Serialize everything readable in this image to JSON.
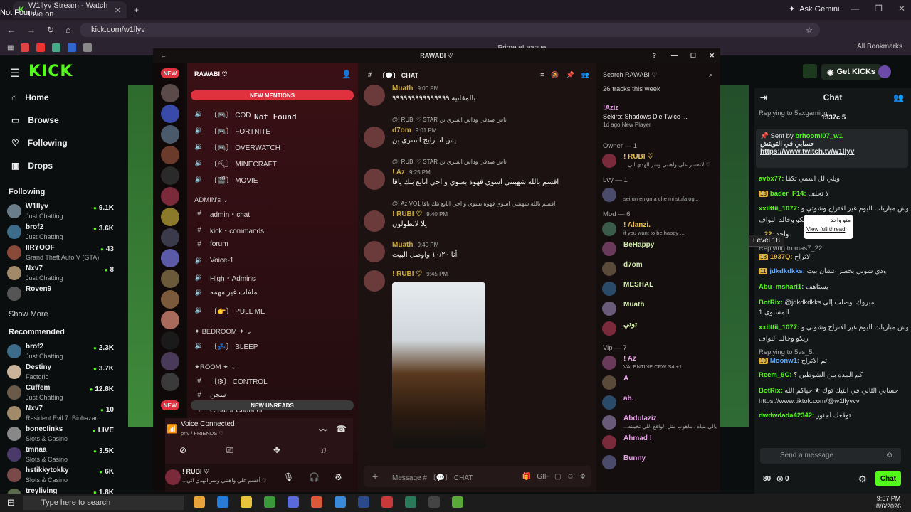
{
  "browser": {
    "tab_title": "W1llyv Stream - Watch Live on",
    "not_found": "Not Found",
    "gemini": "Ask Gemini",
    "url": "kick.com/w1llyv",
    "bookmark_label": "Prime eLeague",
    "all_bookmarks": "All Bookmarks"
  },
  "kick": {
    "logo": "KICK",
    "get_kicks": "Get KICKs",
    "nav": [
      "Home",
      "Browse",
      "Following",
      "Drops"
    ],
    "following_head": "Following",
    "following": [
      {
        "name": "W1llyv",
        "sub": "Just Chatting",
        "views": "9.1K",
        "color": "#6a7d8a"
      },
      {
        "name": "brof2",
        "sub": "Just Chatting",
        "views": "3.6K",
        "color": "#3d6c8a"
      },
      {
        "name": "IIRYOOF",
        "sub": "Grand Theft Auto V (GTA)",
        "views": "43",
        "color": "#8a4a3a"
      },
      {
        "name": "Nxv7",
        "sub": "Just Chatting",
        "views": "8",
        "color": "#a18a6a"
      },
      {
        "name": "Roven9",
        "sub": "",
        "views": "",
        "color": "#555"
      }
    ],
    "show_more": "Show More",
    "recommended_head": "Recommended",
    "recommended": [
      {
        "name": "brof2",
        "sub": "Just Chatting",
        "views": "2.3K",
        "color": "#3d6c8a"
      },
      {
        "name": "Destiny",
        "sub": "Factorio",
        "views": "3.7K",
        "color": "#c9b39a"
      },
      {
        "name": "Cuffem",
        "sub": "Just Chatting",
        "views": "12.8K",
        "color": "#6a5a4a"
      },
      {
        "name": "Nxv7",
        "sub": "Resident Evil 7: Biohazard",
        "views": "10",
        "color": "#a18a6a"
      },
      {
        "name": "bonecIinks",
        "sub": "Slots & Casino",
        "views": "LIVE",
        "color": "#888"
      },
      {
        "name": "tmnaa",
        "sub": "Slots & Casino",
        "views": "3.5K",
        "color": "#4a3a6a"
      },
      {
        "name": "hstikkytokky",
        "sub": "Slots & Casino",
        "views": "6K",
        "color": "#7a4a4a"
      },
      {
        "name": "treyliving",
        "sub": "",
        "views": "1.8K",
        "color": "#5a6a4a"
      }
    ],
    "chat_title": "Chat",
    "chat_top": "1337c 5",
    "pinned_by": "Sent by",
    "pinned_user": "brhoomi07_w1",
    "pinned_text": "حسابي في التويتش",
    "pinned_link": "https://www.twitch.tv/w1llyv",
    "messages": [
      {
        "user": "avbx77:",
        "text": "ويلي لل اسمي تكفا",
        "color": "#53fc18",
        "badge": ""
      },
      {
        "user": "bader_F14:",
        "text": "لا تحلف",
        "color": "#53fc18",
        "badge": "18"
      },
      {
        "user": "xxilttii_1077:",
        "text": "وش مباريات اليوم غير الاتراح وشوتي و",
        "color": "#53fc18",
        "badge": ""
      },
      {
        "user": "",
        "text": "ريكو وخالد النواف",
        "color": "#53fc18",
        "badge": ""
      },
      {
        "user": "...22:",
        "text": "واحد",
        "color": "#e0b43c",
        "badge": ""
      },
      {
        "user": "1937Q:",
        "text": "الاتراح",
        "color": "#e0b43c",
        "badge": "18"
      },
      {
        "user": "jdkdkdkks:",
        "text": "ودي شوتي يخسر عشان بيت",
        "color": "#5fa8ff",
        "badge": "11"
      },
      {
        "user": "Abu_mshari1:",
        "text": "يستاهف",
        "color": "#53fc18",
        "badge": ""
      },
      {
        "user": "BotRix:",
        "text": "@jdkdkdkks مبروك! وصلت إلى",
        "color": "#53fc18",
        "badge": ""
      },
      {
        "user": "",
        "text": "المستوى 1",
        "color": "#53fc18",
        "badge": ""
      },
      {
        "user": "xxilttii_1077:",
        "text": "وش مباريات اليوم غير الاتراح وشوتي و",
        "color": "#53fc18",
        "badge": ""
      },
      {
        "user": "",
        "text": "ريكو وخالد النواف",
        "color": "#53fc18",
        "badge": ""
      },
      {
        "user": "Moonw1:",
        "text": "تم الاتراح",
        "color": "#5fa8ff",
        "badge": "19"
      },
      {
        "user": "Reem_9C:",
        "text": "كم المده بين الشوطين ؟",
        "color": "#53fc18",
        "badge": ""
      },
      {
        "user": "BotRix:",
        "text": "حسابي الثاني في التيك توك ★ حياكم الله",
        "color": "#53fc18",
        "badge": ""
      },
      {
        "user": "",
        "text": "https://www.tiktok.com/@w1llyvvv",
        "color": "#53fc18",
        "badge": ""
      },
      {
        "user": "dwdwdada42342:",
        "text": "توقعك لجنوز",
        "color": "#53fc18",
        "badge": ""
      }
    ],
    "replying1": "Replying to 5axgaming:",
    "replying2": "Replying to mas7_22:",
    "replying3": "Replying to 5vs_5:",
    "level_popup": "Level 18",
    "thread_popup_text": "متو واحد",
    "thread_popup_link": "View full thread",
    "send_placeholder": "Send a message",
    "chat_button": "Chat",
    "points": "80",
    "points2": "0"
  },
  "discord": {
    "server_title": "RAWABI ♡",
    "new_mentions": "NEW MENTIONS",
    "new_unreads": "NEW UNREADS",
    "new_badge": "NEW",
    "channels_top": [
      {
        "icon": "🔊",
        "name": "〔🎮〕 COD"
      },
      {
        "icon": "🔊",
        "name": "〔🎮〕 FORTNITE"
      },
      {
        "icon": "🔊",
        "name": "〔🎮〕 OVERWATCH"
      },
      {
        "icon": "🔊",
        "name": "〔⛏〕 MINECRAFT"
      },
      {
        "icon": "🔊",
        "name": "〔🎬〕 MOVIE"
      }
    ],
    "admins_head": "ADMIN's ⌄",
    "admin_channels": [
      {
        "icon": "#",
        "name": "admin・chat"
      },
      {
        "icon": "#",
        "name": "kick・commands"
      },
      {
        "icon": "#",
        "name": "forum"
      },
      {
        "icon": "🔊",
        "name": "Voice-1"
      },
      {
        "icon": "🔊",
        "name": "High・Admins"
      },
      {
        "icon": "🔊",
        "name": "ملفات غير مهمه"
      },
      {
        "icon": "🔊",
        "name": "〔👉〕 PULL ME"
      }
    ],
    "bedroom_head": "✦ BEDROOM ✦ ⌄",
    "bedroom_channels": [
      {
        "icon": "🔊",
        "name": "〔💤〕 SLEEP"
      }
    ],
    "room_head": "✦ROOM ✦ ⌄",
    "room_channels": [
      {
        "icon": "#",
        "name": "〔⚙〕 CONTROL"
      },
      {
        "icon": "#",
        "name": "سجن"
      },
      {
        "icon": "+",
        "name": "Creator Channel"
      }
    ],
    "not_found": "Not Found",
    "voice_connected": "Voice Connected",
    "voice_sub": "priv / FRIENDS ♡",
    "user_name": "! RUBI ♡",
    "user_status": "...أقسم علي واهتني وسر الهدي اني ♡",
    "chat_channel": "〔💬〕 CHAT",
    "messages": [
      {
        "name": "Muath",
        "time": "9:00 PM",
        "text": "بالمقاتيه ٩٩٩٩٩٩٩٩٩٩٩٩٩٩٩",
        "reply": ""
      },
      {
        "name": "d7om",
        "time": "9:01 PM",
        "text": "يس انا رايح اشتري بن",
        "reply": "@! RUBI ♡ STAR  ناس صدقي وداس اشتري بن"
      },
      {
        "name": "! Az",
        "time": "9:25 PM",
        "text": "اقسم بالله شهيتني اسوي قهوة بسوي و اجي اتابع بثك ياقا",
        "reply": "@! RUBI ♡ STAR  ناس صدقي وداس اشتري بن"
      },
      {
        "name": "! RUBI ♡",
        "time": "9:40 PM",
        "text": "يلا لاتطولون",
        "reply": "@! Az VO1  اقسم بالله شهيتني اسوي قهوة بسوي و اجي اتابع بثك ياقا"
      },
      {
        "name": "Muath",
        "time": "9:40 PM",
        "text": "أنا ١٠/٢٠ واوصل البيت",
        "reply": ""
      },
      {
        "name": "! RUBI ♡",
        "time": "9:45 PM",
        "text": "",
        "reply": ""
      }
    ],
    "input_placeholder": "Message # 〔💬〕 CHAT",
    "search_placeholder": "Search RAWABI ♡",
    "members_top": "26 tracks this week",
    "activity_user": "!Aziz",
    "activity_game": "Sekiro: Shadows Die Twice ...",
    "activity_meta": "1d ago  New Player",
    "groups": [
      {
        "head": "Owner — 1",
        "members": [
          {
            "name": "! RUBI ♡",
            "status": "...لاتفسر علي واهتني وسر الهدي اني ♡",
            "color": "#e6c04a"
          }
        ]
      },
      {
        "head": "Lvy — 1",
        "members": [
          {
            "name": "​",
            "status": "sei un enigma che mi stufa og...",
            "color": "#ccc"
          }
        ]
      },
      {
        "head": "Mod — 6",
        "members": [
          {
            "name": "! Alanzi.",
            "status": "if you want to be happy ...",
            "color": "#e6c04a"
          },
          {
            "name": "BeHappy",
            "status": "",
            "color": "#cfe8a6"
          },
          {
            "name": "d7om",
            "status": "",
            "color": "#cfe8a6"
          },
          {
            "name": "MESHAL",
            "status": "",
            "color": "#cfe8a6"
          },
          {
            "name": "Muath",
            "status": "",
            "color": "#cfe8a6"
          },
          {
            "name": "توتي",
            "status": "",
            "color": "#cfe8a6"
          }
        ]
      },
      {
        "head": "Vip — 7",
        "members": [
          {
            "name": "! Az",
            "status": "VALENTINE CFW S4 +1",
            "color": "#e6a3e6"
          },
          {
            "name": "A",
            "status": "",
            "color": "#e6a3e6"
          },
          {
            "name": "ab.",
            "status": "",
            "color": "#e6a3e6"
          },
          {
            "name": "Abdulaziz",
            "status": "...يالي بنياه ، ماهوب مثل الواقع اللي تخيلته",
            "color": "#e6a3e6"
          },
          {
            "name": "Ahmad !",
            "status": "",
            "color": "#e6a3e6"
          },
          {
            "name": "Bunny",
            "status": "",
            "color": "#e6a3e6"
          }
        ]
      }
    ]
  },
  "taskbar": {
    "search": "Type here to search",
    "time": "9:57 PM",
    "date": "8/6/2026"
  }
}
